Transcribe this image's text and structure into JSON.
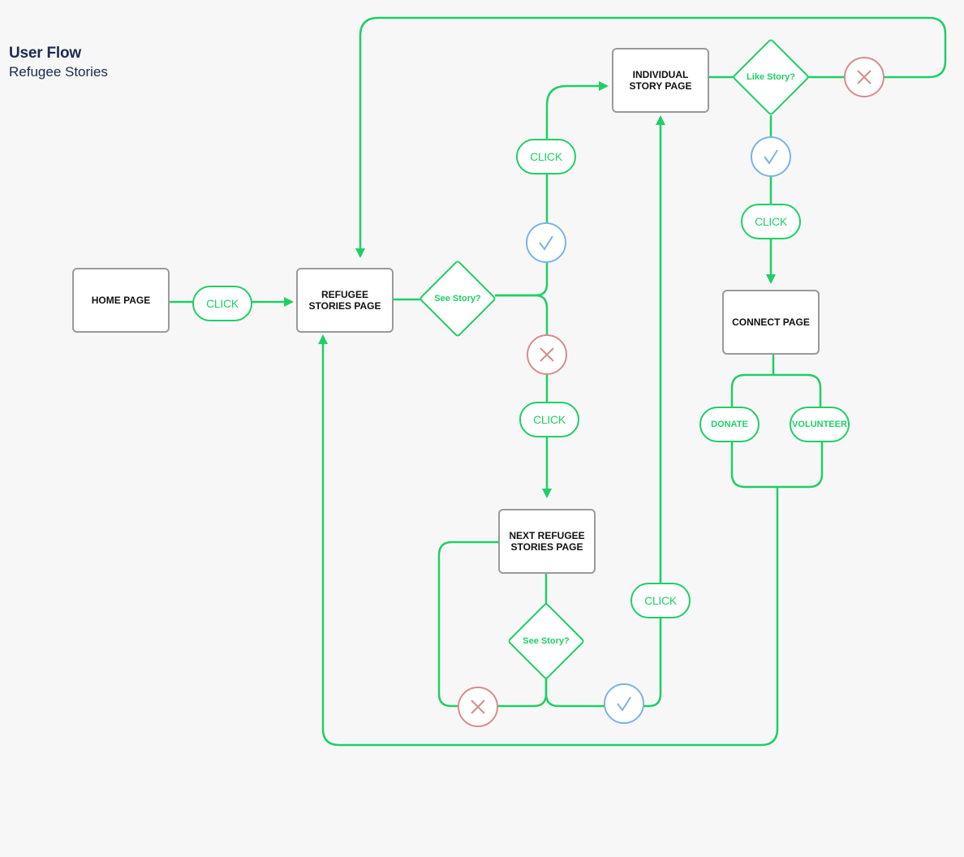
{
  "header": {
    "title": "User Flow",
    "subtitle": "Refugee Stories"
  },
  "colors": {
    "flow": "#1fcf66",
    "yes": "#7ab3e8",
    "no": "#d98b8b",
    "box_border": "#9a9a9a",
    "title": "#1b2a4e"
  },
  "pages": {
    "home": "HOME PAGE",
    "refugee_stories": "REFUGEE STORIES PAGE",
    "individual_story": "INDIVIDUAL STORY PAGE",
    "connect": "CONNECT PAGE",
    "next_refugee_stories": "NEXT REFUGEE STORIES PAGE"
  },
  "decisions": {
    "see_story_1": "See Story?",
    "like_story": "Like Story?",
    "see_story_2": "See Story?"
  },
  "actions": {
    "click": "CLICK",
    "donate": "DONATE",
    "volunteer": "VOLUNTEER"
  },
  "outcome_icons": {
    "yes": "check-icon",
    "no": "x-icon"
  }
}
